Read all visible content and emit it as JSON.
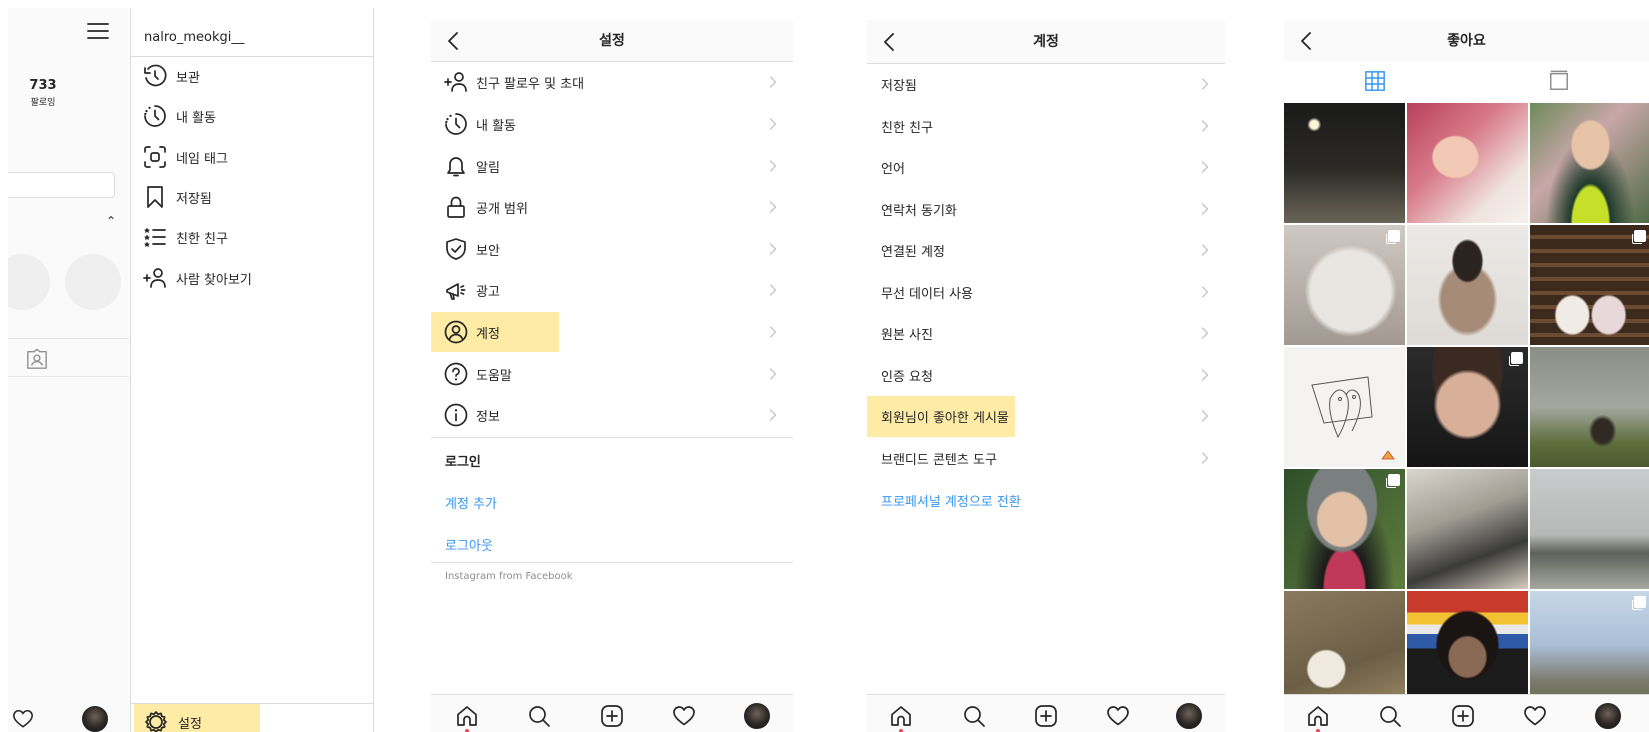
{
  "colors": {
    "highlight": "#fdeba6",
    "link": "#3897f0",
    "text": "#262626",
    "divider": "#dbdbdb",
    "active_dot": "#ed4956"
  },
  "profile_panel": {
    "hamburger_icon": "hamburger-menu-icon",
    "following_count": "733",
    "following_label": "팔로잉",
    "tagged_icon": "tagged-photos-icon",
    "nav_heart_icon": "heart-icon"
  },
  "drawer": {
    "username": "nalro_meokgi__",
    "items": [
      {
        "label": "보관",
        "icon": "archive-icon"
      },
      {
        "label": "내 활동",
        "icon": "activity-icon"
      },
      {
        "label": "네임 태그",
        "icon": "nametag-icon"
      },
      {
        "label": "저장됨",
        "icon": "bookmark-icon"
      },
      {
        "label": "친한 친구",
        "icon": "close-friends-icon"
      },
      {
        "label": "사람 찾아보기",
        "icon": "add-person-icon"
      }
    ],
    "settings_label": "설정",
    "settings_icon": "gear-icon"
  },
  "settings": {
    "title": "설정",
    "back_icon": "chevron-left-icon",
    "items": [
      {
        "label": "친구 팔로우 및 초대",
        "icon": "add-person-icon"
      },
      {
        "label": "내 활동",
        "icon": "activity-icon"
      },
      {
        "label": "알림",
        "icon": "bell-icon"
      },
      {
        "label": "공개 범위",
        "icon": "lock-icon"
      },
      {
        "label": "보안",
        "icon": "shield-icon"
      },
      {
        "label": "광고",
        "icon": "megaphone-icon"
      },
      {
        "label": "계정",
        "icon": "account-icon"
      },
      {
        "label": "도움말",
        "icon": "help-icon"
      },
      {
        "label": "정보",
        "icon": "info-icon"
      }
    ],
    "login_header": "로그인",
    "add_account": "계정 추가",
    "logout": "로그아웃",
    "footer": "Instagram from Facebook"
  },
  "account": {
    "title": "계정",
    "back_icon": "chevron-left-icon",
    "items": [
      {
        "label": "저장됨"
      },
      {
        "label": "친한 친구"
      },
      {
        "label": "언어"
      },
      {
        "label": "연락처 동기화"
      },
      {
        "label": "연결된 계정"
      },
      {
        "label": "무선 데이터 사용"
      },
      {
        "label": "원본 사진"
      },
      {
        "label": "인증 요청"
      },
      {
        "label": "회원님이 좋아한 게시물"
      },
      {
        "label": "브랜디드 콘텐츠 도구"
      }
    ],
    "switch_pro": "프로페셔널 계정으로 전환"
  },
  "liked": {
    "title": "좋아요",
    "back_icon": "chevron-left-icon",
    "grid_tab_icon": "grid-icon",
    "feed_tab_icon": "feed-view-icon",
    "multi_icon": "multiple-photos-icon"
  },
  "bottom_nav": {
    "icons": [
      "home-icon",
      "search-icon",
      "new-post-icon",
      "heart-icon",
      "profile-avatar"
    ]
  }
}
